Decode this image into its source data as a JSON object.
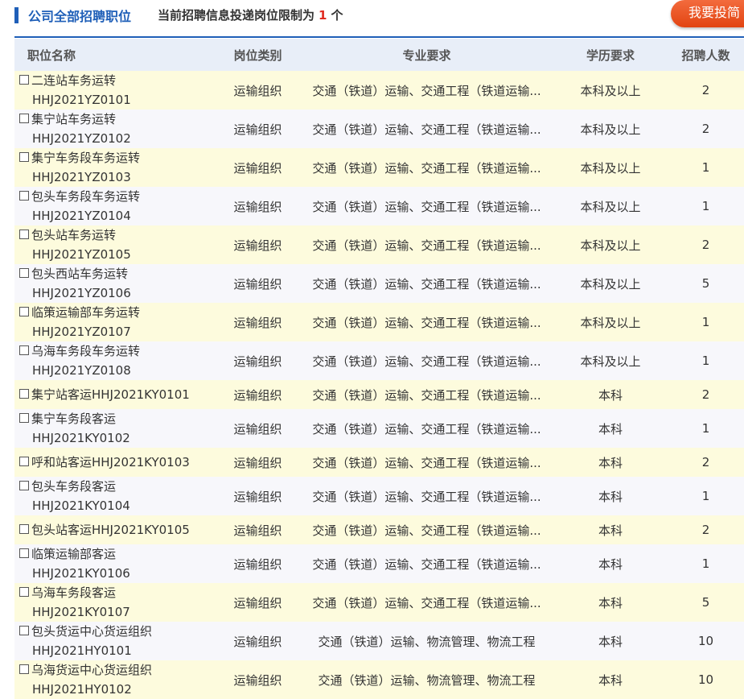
{
  "header": {
    "title": "公司全部招聘职位",
    "notice_prefix": "当前招聘信息投递岗位限制为",
    "limit": "1",
    "notice_suffix": "个",
    "apply_button": "我要投简"
  },
  "columns": {
    "name": "职位名称",
    "category": "岗位类别",
    "major": "专业要求",
    "education": "学历要求",
    "count": "招聘人数"
  },
  "rows": [
    {
      "name": "二连站车务运转",
      "code": "HHJ2021YZ0101",
      "category": "运输组织",
      "major": "交通（铁道）运输、交通工程（铁道运输...",
      "education": "本科及以上",
      "count": "2"
    },
    {
      "name": "集宁站车务运转",
      "code": "HHJ2021YZ0102",
      "category": "运输组织",
      "major": "交通（铁道）运输、交通工程（铁道运输...",
      "education": "本科及以上",
      "count": "2"
    },
    {
      "name": "集宁车务段车务运转",
      "code": "HHJ2021YZ0103",
      "category": "运输组织",
      "major": "交通（铁道）运输、交通工程（铁道运输...",
      "education": "本科及以上",
      "count": "1"
    },
    {
      "name": "包头车务段车务运转",
      "code": "HHJ2021YZ0104",
      "category": "运输组织",
      "major": "交通（铁道）运输、交通工程（铁道运输...",
      "education": "本科及以上",
      "count": "1"
    },
    {
      "name": "包头站车务运转",
      "code": "HHJ2021YZ0105",
      "category": "运输组织",
      "major": "交通（铁道）运输、交通工程（铁道运输...",
      "education": "本科及以上",
      "count": "2"
    },
    {
      "name": "包头西站车务运转",
      "code": "HHJ2021YZ0106",
      "category": "运输组织",
      "major": "交通（铁道）运输、交通工程（铁道运输...",
      "education": "本科及以上",
      "count": "5"
    },
    {
      "name": "临策运输部车务运转",
      "code": "HHJ2021YZ0107",
      "category": "运输组织",
      "major": "交通（铁道）运输、交通工程（铁道运输...",
      "education": "本科及以上",
      "count": "1"
    },
    {
      "name": "乌海车务段车务运转",
      "code": "HHJ2021YZ0108",
      "category": "运输组织",
      "major": "交通（铁道）运输、交通工程（铁道运输...",
      "education": "本科及以上",
      "count": "1"
    },
    {
      "name": "集宁站客运HHJ2021KY0101",
      "code": "",
      "category": "运输组织",
      "major": "交通（铁道）运输、交通工程（铁道运输...",
      "education": "本科",
      "count": "2"
    },
    {
      "name": "集宁车务段客运",
      "code": "HHJ2021KY0102",
      "category": "运输组织",
      "major": "交通（铁道）运输、交通工程（铁道运输...",
      "education": "本科",
      "count": "1"
    },
    {
      "name": "呼和站客运HHJ2021KY0103",
      "code": "",
      "category": "运输组织",
      "major": "交通（铁道）运输、交通工程（铁道运输...",
      "education": "本科",
      "count": "2"
    },
    {
      "name": "包头车务段客运",
      "code": "HHJ2021KY0104",
      "category": "运输组织",
      "major": "交通（铁道）运输、交通工程（铁道运输...",
      "education": "本科",
      "count": "1"
    },
    {
      "name": "包头站客运HHJ2021KY0105",
      "code": "",
      "category": "运输组织",
      "major": "交通（铁道）运输、交通工程（铁道运输...",
      "education": "本科",
      "count": "2"
    },
    {
      "name": "临策运输部客运",
      "code": "HHJ2021KY0106",
      "category": "运输组织",
      "major": "交通（铁道）运输、交通工程（铁道运输...",
      "education": "本科",
      "count": "1"
    },
    {
      "name": "乌海车务段客运",
      "code": "HHJ2021KY0107",
      "category": "运输组织",
      "major": "交通（铁道）运输、交通工程（铁道运输...",
      "education": "本科",
      "count": "5"
    },
    {
      "name": "包头货运中心货运组织",
      "code": "HHJ2021HY0101",
      "category": "运输组织",
      "major": "交通（铁道）运输、物流管理、物流工程",
      "education": "本科",
      "count": "10"
    },
    {
      "name": "乌海货运中心货运组织",
      "code": "HHJ2021HY0102",
      "category": "运输组织",
      "major": "交通（铁道）运输、物流管理、物流工程",
      "education": "本科",
      "count": "10"
    }
  ]
}
